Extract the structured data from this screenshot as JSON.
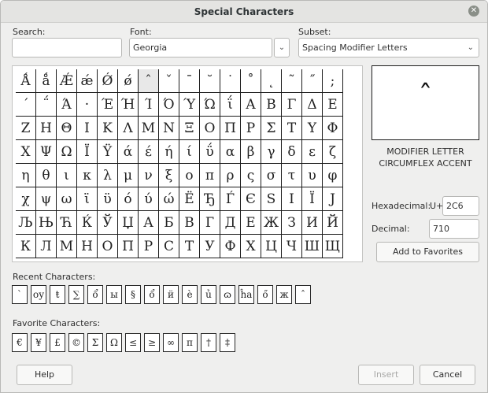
{
  "dialog": {
    "title": "Special Characters"
  },
  "search": {
    "label": "Search:",
    "value": ""
  },
  "font": {
    "label": "Font:",
    "value": "Georgia"
  },
  "subset": {
    "label": "Subset:",
    "value": "Spacing Modifier Letters"
  },
  "grid": {
    "selected_char": "ˆ",
    "rows": [
      [
        "Ǻ",
        "ǻ",
        "Ǽ",
        "ǽ",
        "Ǿ",
        "ǿ",
        "ˆ",
        "ˇ",
        "ˉ",
        "˘",
        "˙",
        "˚",
        "˛",
        "˜",
        "˝",
        ";"
      ],
      [
        "΄",
        "΅",
        "Ά",
        "·",
        "Έ",
        "Ή",
        "Ί",
        "Ό",
        "Ύ",
        "Ώ",
        "ΐ",
        "Α",
        "Β",
        "Γ",
        "Δ",
        "Ε"
      ],
      [
        "Ζ",
        "Η",
        "Θ",
        "Ι",
        "Κ",
        "Λ",
        "Μ",
        "Ν",
        "Ξ",
        "Ο",
        "Π",
        "Ρ",
        "Σ",
        "Τ",
        "Υ",
        "Φ"
      ],
      [
        "Χ",
        "Ψ",
        "Ω",
        "Ϊ",
        "Ϋ",
        "ά",
        "έ",
        "ή",
        "ί",
        "ΰ",
        "α",
        "β",
        "γ",
        "δ",
        "ε",
        "ζ"
      ],
      [
        "η",
        "θ",
        "ι",
        "κ",
        "λ",
        "μ",
        "ν",
        "ξ",
        "ο",
        "π",
        "ρ",
        "ς",
        "σ",
        "τ",
        "υ",
        "φ"
      ],
      [
        "χ",
        "ψ",
        "ω",
        "ϊ",
        "ϋ",
        "ό",
        "ύ",
        "ώ",
        "Ё",
        "Ђ",
        "Ѓ",
        "Є",
        "Ѕ",
        "І",
        "Ї",
        "Ј"
      ],
      [
        "Љ",
        "Њ",
        "Ћ",
        "Ќ",
        "Ў",
        "Џ",
        "А",
        "Б",
        "В",
        "Г",
        "Д",
        "Е",
        "Ж",
        "З",
        "И",
        "Й"
      ],
      [
        "К",
        "Л",
        "М",
        "Н",
        "О",
        "П",
        "Р",
        "С",
        "Т",
        "У",
        "Ф",
        "Х",
        "Ц",
        "Ч",
        "Ш",
        "Щ"
      ]
    ]
  },
  "preview": {
    "char": "ˆ",
    "name_line1": "MODIFIER LETTER",
    "name_line2": "CIRCUMFLEX ACCENT"
  },
  "hex": {
    "label": "Hexadecimal:",
    "prefix": "U+",
    "value": "2C6"
  },
  "decimal": {
    "label": "Decimal:",
    "value": "710"
  },
  "buttons": {
    "add_to_favorites": "Add to Favorites",
    "help": "Help",
    "insert": "Insert",
    "cancel": "Cancel"
  },
  "recent": {
    "label": "Recent Characters:",
    "items": [
      "ˋ",
      "օу",
      "ŧ",
      "∑",
      "ổ",
      "ы",
      "§",
      "ổ",
      "ӥ",
      "è",
      "ủ",
      "ɷ",
      "ĥa",
      "ő",
      "ж",
      "ˆ"
    ]
  },
  "favorites": {
    "label": "Favorite Characters:",
    "items": [
      "€",
      "¥",
      "£",
      "©",
      "Σ",
      "Ω",
      "≤",
      "≥",
      "∞",
      "π",
      "†",
      "‡"
    ]
  }
}
